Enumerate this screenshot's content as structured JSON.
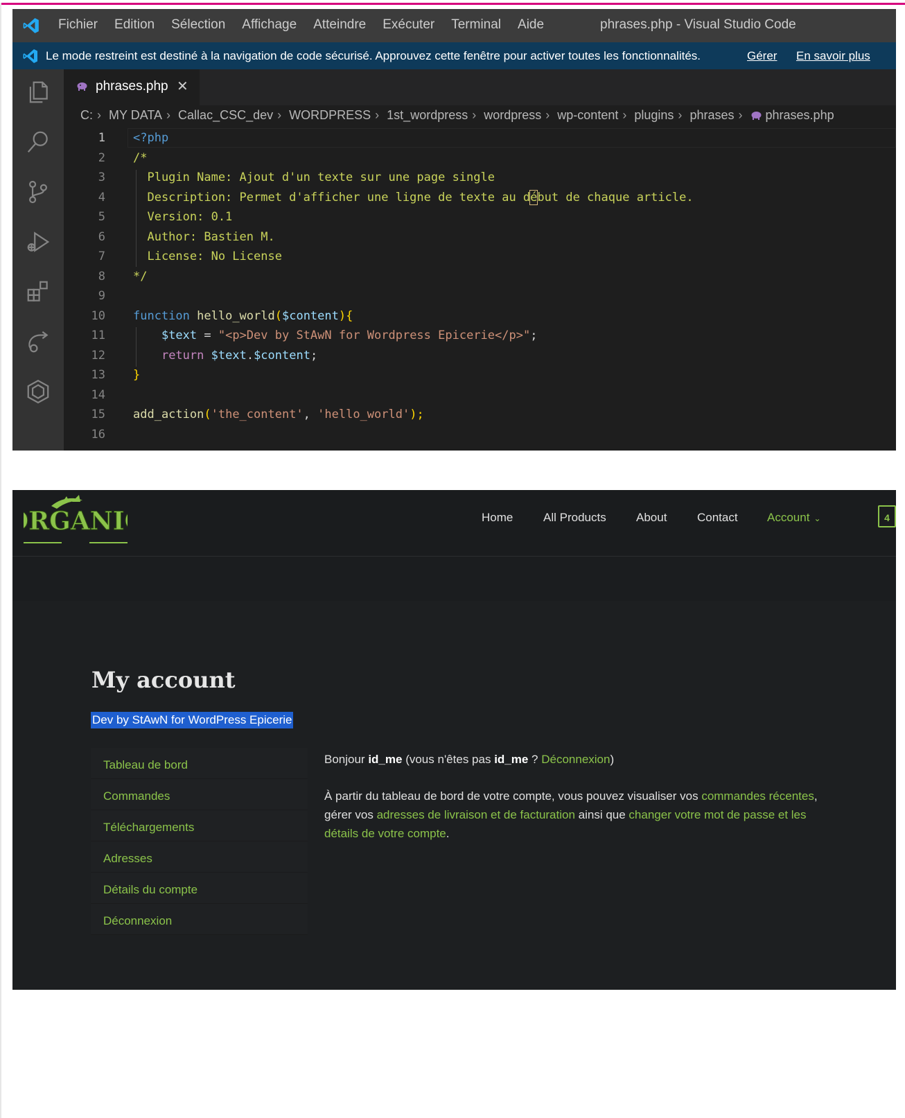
{
  "vscode": {
    "menu": [
      "Fichier",
      "Edition",
      "Sélection",
      "Affichage",
      "Atteindre",
      "Exécuter",
      "Terminal",
      "Aide"
    ],
    "window_title": "phrases.php - Visual Studio Code",
    "banner": {
      "text": "Le mode restreint est destiné à la navigation de code sécurisé. Approuvez cette fenêtre pour activer toutes les fonctionnalités.",
      "manage": "Gérer",
      "learn_more": "En savoir plus"
    },
    "activity_icons": [
      "explorer-icon",
      "search-icon",
      "source-control-icon",
      "run-debug-icon",
      "extensions-icon",
      "remote-icon",
      "box-icon"
    ],
    "tab": {
      "name": "phrases.php",
      "close": "✕",
      "icon": "php-icon"
    },
    "breadcrumb": [
      "C:",
      "MY DATA",
      "Callac_CSC_dev",
      "WORDPRESS",
      "1st_wordpress",
      "wordpress",
      "wp-content",
      "plugins",
      "phrases",
      "phrases.php"
    ],
    "code": {
      "l1": "<?php",
      "l2": "/*",
      "l3": "  Plugin Name: Ajout d'un texte sur une page single",
      "l4a": "  Description: Permet d'afficher une ligne de texte au d",
      "l4b": "é",
      "l4c": "but de chaque article.",
      "l5": "  Version: 0.1",
      "l6": "  Author: Bastien M.",
      "l7": "  License: No License",
      "l8": "*/",
      "l10_kw": "function",
      "l10_fn": "hello_world",
      "l10_p1": "(",
      "l10_var": "$content",
      "l10_p2": "){",
      "l11_var": "$text",
      "l11_eq": " = ",
      "l11_str": "\"<p>Dev by StAwN for Wordpress Epicerie</p>\"",
      "l11_end": ";",
      "l12_kw": "return",
      "l12_v1": "$text",
      "l12_dot": ".",
      "l12_v2": "$content",
      "l12_end": ";",
      "l13": "}",
      "l15_fn": "add_action",
      "l15_p1": "(",
      "l15_s1": "'the_content'",
      "l15_c": ", ",
      "l15_s2": "'hello_world'",
      "l15_p2": ");"
    },
    "line_numbers": [
      "1",
      "2",
      "3",
      "4",
      "5",
      "6",
      "7",
      "8",
      "9",
      "10",
      "11",
      "12",
      "13",
      "14",
      "15",
      "16"
    ]
  },
  "site": {
    "logo_text": "ORGANIC",
    "nav": [
      "Home",
      "All Products",
      "About",
      "Contact",
      "Account"
    ],
    "cart_count": "4",
    "page_title": "My account",
    "injected_text": "Dev by StAwN for WordPress Epicerie",
    "account_menu": [
      "Tableau de bord",
      "Commandes",
      "Téléchargements",
      "Adresses",
      "Détails du compte",
      "Déconnexion"
    ],
    "greeting": {
      "hello": "Bonjour ",
      "user": "id_me",
      "mid": " (vous n'êtes pas ",
      "user2": "id_me",
      "q": " ? ",
      "logout": "Déconnexion",
      "end": ")"
    },
    "intro": {
      "t1": "À partir du tableau de bord de votre compte, vous pouvez visualiser vos ",
      "l1": "commandes récentes",
      "t2": ", gérer vos ",
      "l2": "adresses de livraison et de facturation",
      "t3": " ainsi que ",
      "l3": "changer votre mot de passe et les détails de votre compte",
      "t4": "."
    },
    "colors": {
      "accent": "#8bc34a",
      "selection": "#1f5fcf",
      "background": "#1d1f21"
    }
  }
}
